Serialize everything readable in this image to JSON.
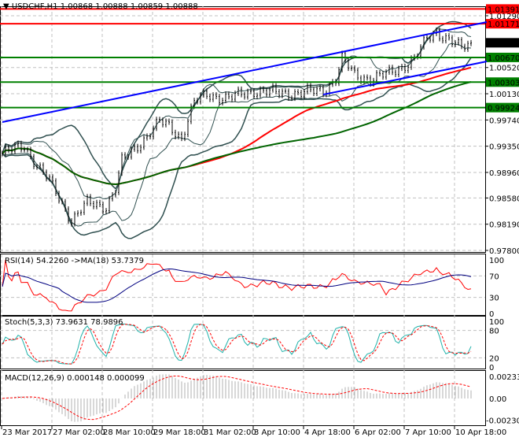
{
  "header": {
    "symbol": "USDCHF,H1",
    "ohlc": "1.00868 1.00888 1.00859 1.00888"
  },
  "chart_data": [
    {
      "type": "candlestick",
      "title": "USDCHF,H1",
      "ylim": [
        0.978,
        1.0139
      ],
      "y_ticks": [
        "1.01290",
        "1.00520",
        "1.00130",
        "0.99740",
        "0.99350",
        "0.98960",
        "0.98580",
        "0.98190",
        "0.97800"
      ],
      "price_tags": [
        {
          "label": "1.01391",
          "value": 1.01391,
          "color": "#ff0000"
        },
        {
          "label": "1.01171",
          "value": 1.01171,
          "color": "#ff0000"
        },
        {
          "label": "1.00888",
          "value": 1.00888,
          "color": "#000000"
        },
        {
          "label": "1.00670",
          "value": 1.0067,
          "color": "#008000"
        },
        {
          "label": "1.00303",
          "value": 1.00303,
          "color": "#008000"
        },
        {
          "label": "0.99924",
          "value": 0.99924,
          "color": "#008000"
        }
      ],
      "close_keypoints": [
        [
          0,
          0.9924
        ],
        [
          7,
          0.99357
        ],
        [
          11,
          0.99065
        ],
        [
          15,
          0.9883
        ],
        [
          20,
          0.98421
        ],
        [
          22,
          0.98245
        ],
        [
          27,
          0.98503
        ],
        [
          33,
          0.98456
        ],
        [
          36,
          0.98713
        ],
        [
          38,
          0.99123
        ],
        [
          43,
          0.99357
        ],
        [
          50,
          0.99709
        ],
        [
          53,
          0.9965
        ],
        [
          57,
          0.99475
        ],
        [
          61,
          1.00001
        ],
        [
          65,
          1.00118
        ],
        [
          72,
          1.0006
        ],
        [
          80,
          1.00177
        ],
        [
          87,
          1.00142
        ],
        [
          95,
          1.00142
        ],
        [
          102,
          1.00177
        ],
        [
          106,
          1.00353
        ],
        [
          108,
          1.00646
        ],
        [
          112,
          1.00411
        ],
        [
          117,
          1.00353
        ],
        [
          122,
          1.00411
        ],
        [
          127,
          1.00528
        ],
        [
          131,
          1.00646
        ],
        [
          135,
          1.00939
        ],
        [
          138,
          1.01055
        ],
        [
          142,
          1.00939
        ],
        [
          146,
          1.00798
        ],
        [
          149,
          1.00888
        ]
      ],
      "trendlines": [
        {
          "color": "#0000ff",
          "from": [
            0,
            0.99709
          ],
          "to": [
            154,
            1.01196
          ]
        },
        {
          "color": "#0000ff",
          "from": [
            102,
            1.00118
          ],
          "to": [
            154,
            1.00611
          ]
        }
      ],
      "x_ticks": [
        "23 Mar 2017",
        "27 Mar 02:00",
        "28 Mar 10:00",
        "29 Mar 18:00",
        "31 Mar 02:00",
        "3 Apr 10:00",
        "4 Apr 18:00",
        "6 Apr 02:00",
        "7 Apr 10:00",
        "10 Apr 18:00"
      ]
    },
    {
      "type": "line",
      "title": "RSI(14) 54.2260  ->MA(18) 53.7379",
      "ylim": [
        0,
        100
      ],
      "y_ticks": [
        "100",
        "70",
        "30",
        "0"
      ]
    },
    {
      "type": "line",
      "title": "Stoch(5,3,3) 73.9631 78.9896",
      "ylim": [
        0,
        100
      ],
      "y_ticks": [
        "100",
        "80",
        "20",
        "0"
      ]
    },
    {
      "type": "bar",
      "title": "MACD(12,26,9) 0.000148 0.000099",
      "ylim": [
        -0.002306,
        0.002334
      ],
      "y_ticks": [
        "0.002334",
        "0.00",
        "-0.002306"
      ]
    }
  ]
}
